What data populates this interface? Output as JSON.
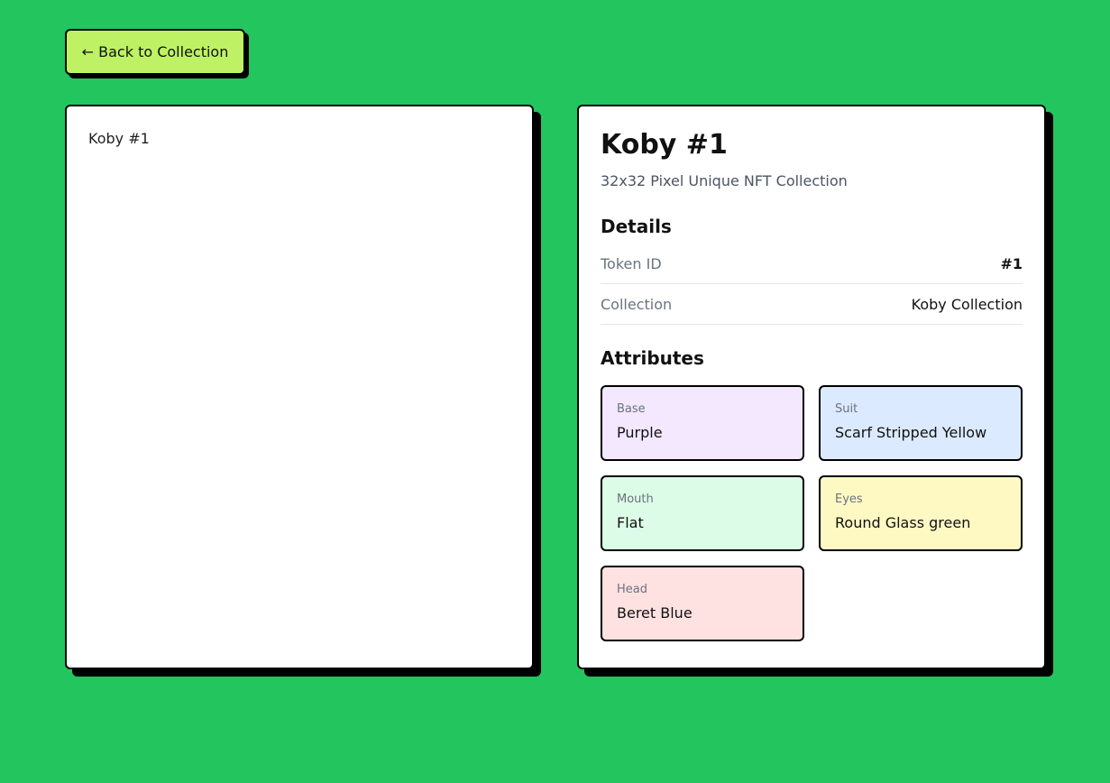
{
  "nav": {
    "back_label": "← Back to Collection"
  },
  "image": {
    "alt": "Koby #1"
  },
  "item": {
    "title": "Koby #1",
    "subtitle": "32x32 Pixel Unique NFT Collection"
  },
  "details": {
    "heading": "Details",
    "rows": [
      {
        "label": "Token ID",
        "value": "#1"
      },
      {
        "label": "Collection",
        "value": "Koby Collection"
      }
    ]
  },
  "attributes": {
    "heading": "Attributes",
    "items": [
      {
        "label": "Base",
        "value": "Purple",
        "color": "#f3e8ff"
      },
      {
        "label": "Suit",
        "value": "Scarf Stripped Yellow",
        "color": "#dbeafe"
      },
      {
        "label": "Mouth",
        "value": "Flat",
        "color": "#dcfce7"
      },
      {
        "label": "Eyes",
        "value": "Round Glass green",
        "color": "#fef9c3"
      },
      {
        "label": "Head",
        "value": "Beret Blue",
        "color": "#fee2e2"
      }
    ]
  },
  "colors": {
    "page_background": "#22c55e",
    "back_button": "#bef264"
  }
}
